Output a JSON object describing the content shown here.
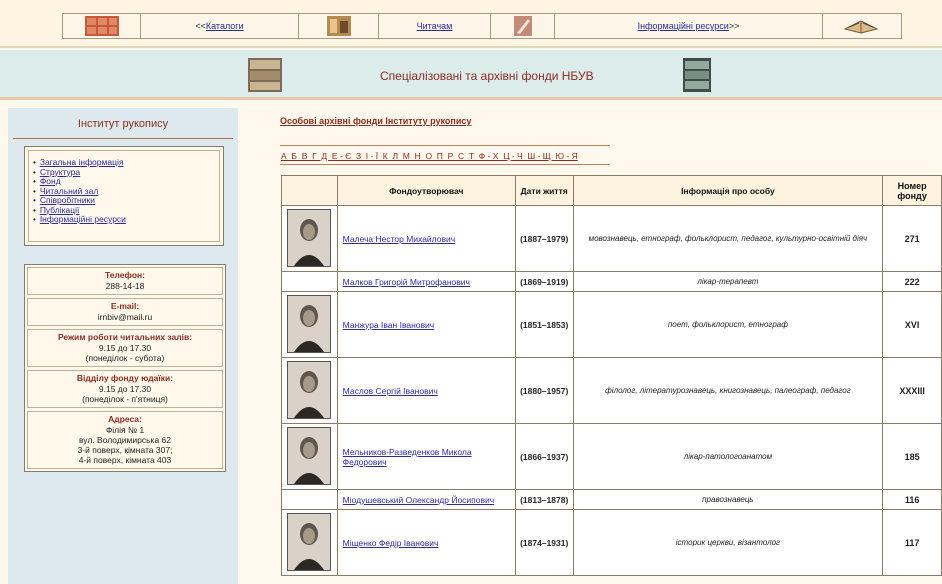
{
  "topnav": {
    "items": [
      {
        "type": "icon",
        "icon": "catalog-cabinet-icon"
      },
      {
        "type": "link",
        "prefix": "<< ",
        "label": "Каталоги"
      },
      {
        "type": "icon",
        "icon": "readers-icon"
      },
      {
        "type": "link",
        "label": "Читачам"
      },
      {
        "type": "icon",
        "icon": "manuscript-icon"
      },
      {
        "type": "link",
        "label": "Інформаційні ресурси",
        "suffix": " >>"
      },
      {
        "type": "icon",
        "icon": "open-book-icon"
      }
    ]
  },
  "banner": {
    "title": "Спеціалізовані та архівні фонди НБУВ"
  },
  "sidebar": {
    "title": "Інститут рукопису",
    "menu": [
      "Загальна інформація",
      "Структура",
      "Фонд",
      "Читальний зал",
      "Співробітники",
      "Публікації",
      "Інформаційні ресурси"
    ],
    "contacts": [
      {
        "heading": "Телефон:",
        "lines": [
          "288-14-18"
        ]
      },
      {
        "heading": "E-mail:",
        "lines": [
          "irnbiv@mail.ru"
        ]
      },
      {
        "heading": "Режим роботи читальних залів:",
        "lines": [
          "9.15 до 17.30",
          "(понеділок - субота)"
        ]
      },
      {
        "heading": "Відділу фонду юдаїки:",
        "lines": [
          "9.15 до 17.30",
          "(понеділок - п'ятниця)"
        ]
      },
      {
        "heading": "Адреса:",
        "lines": [
          "Філія № 1",
          "вул. Володимирська 62",
          "3-й поверх, кімната 307;",
          "4-й поверх, кімната 403"
        ]
      }
    ]
  },
  "content": {
    "section_link": "Особові архівні фонди Інституту рукопису",
    "alphabet": "А  Б  В  Г  Д  Е - Є  З  І - Ї  К  Л  М  Н  О  П  Р  С  Т  Ф - Х  Ц - Ч  Ш - Щ  Ю - Я",
    "table": {
      "headers": [
        "",
        "Фондоутворювач",
        "Дати життя",
        "Інформація про особу",
        "Номер фонду"
      ],
      "rows": [
        {
          "photo": true,
          "name": "Малеча Нестор Михайлович",
          "dates": "(1887–1979)",
          "info": "мовознавець, етнограф, фольклорист, педагог, культурно-освітній діяч",
          "num": "271"
        },
        {
          "photo": false,
          "name": "Малков Григорій Митрофанович",
          "dates": "(1869–1919)",
          "info": "лікар-терапевт",
          "num": "222"
        },
        {
          "photo": true,
          "name": "Манжура Іван Іванович",
          "dates": "(1851–1853)",
          "info": "поет, фольклорист, етнограф",
          "num": "XVI"
        },
        {
          "photo": true,
          "name": "Маслов Сергій Іванович",
          "dates": "(1880–1957)",
          "info": "філолог, літературознавець, книгознавець, палеограф, педагог",
          "num": "XXXIII"
        },
        {
          "photo": true,
          "name": "Мельников-Разведенков Микола Федорович",
          "dates": "(1866–1937)",
          "info": "лікар-патологоанатом",
          "num": "185"
        },
        {
          "photo": false,
          "name": "Міодушевський Олександр Йосипович",
          "dates": "(1813–1878)",
          "info": "правознавець",
          "num": "116"
        },
        {
          "photo": true,
          "name": "Міщенко Федір Іванович",
          "dates": "(1874–1931)",
          "info": "історик церкви, візантолог",
          "num": "117"
        }
      ]
    }
  }
}
